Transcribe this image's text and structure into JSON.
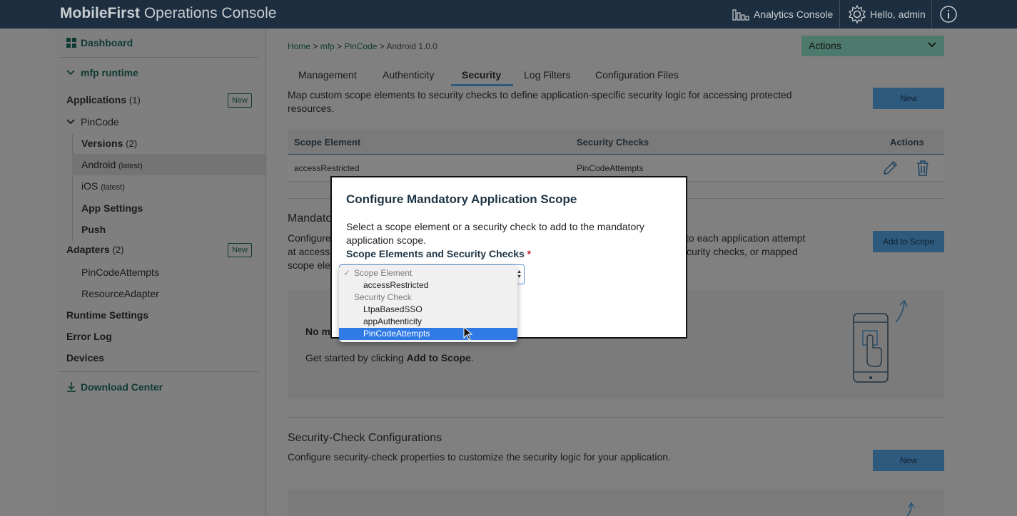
{
  "topbar": {
    "brand_bold": "MobileFirst",
    "brand_rest": " Operations Console",
    "analytics": "Analytics Console",
    "user": "Hello, admin"
  },
  "sidebar": {
    "dashboard": "Dashboard",
    "runtime": "mfp runtime",
    "applications": "Applications",
    "applications_count": "(1)",
    "new_label": "New",
    "pincode": "PinCode",
    "versions": "Versions",
    "versions_count": "(2)",
    "android": "Android",
    "android_tag": "(latest)",
    "ios": "iOS",
    "ios_tag": "(latest)",
    "app_settings": "App Settings",
    "push": "Push",
    "adapters": "Adapters",
    "adapters_count": "(2)",
    "adapter_1": "PinCodeAttempts",
    "adapter_2": "ResourceAdapter",
    "runtime_settings": "Runtime Settings",
    "error_log": "Error Log",
    "devices": "Devices",
    "download_center": "Download Center"
  },
  "breadcrumb": {
    "home": "Home",
    "runtime": "mfp",
    "app": "PinCode",
    "current": "Android 1.0.0",
    "sep": ">"
  },
  "actions_label": "Actions",
  "tabs": [
    "Management",
    "Authenticity",
    "Security",
    "Log Filters",
    "Configuration Files"
  ],
  "scope_section": {
    "description": "Map custom scope elements to security checks to define application-specific security logic for accessing protected resources.",
    "new_button": "New",
    "col_scope": "Scope Element",
    "col_checks": "Security Checks",
    "col_actions": "Actions",
    "row_scope": "accessRestricted",
    "row_checks": "PinCodeAttempts"
  },
  "mandatory_section": {
    "title_partial": "Mandato",
    "line1_left": "Configure",
    "line1_right": "to each application attempt",
    "line2_left": "at access",
    "line2_right": "curity checks, or mapped",
    "line3_left": "scope ele",
    "add_button": "Add to Scope",
    "empty_partial": "No m",
    "get_started_prefix": "Get started by clicking ",
    "get_started_bold": "Add to Scope",
    "get_started_suffix": "."
  },
  "security_check_section": {
    "title": "Security-Check Configurations",
    "description": "Configure security-check properties to customize the security logic for your application.",
    "new_button": "New"
  },
  "modal": {
    "title": "Configure Mandatory Application Scope",
    "text": "Select a scope element or a security check to add to the mandatory application scope.",
    "label": "Scope Elements and Security Checks",
    "required_mark": "*"
  },
  "dropdown": {
    "check_mark": "✓",
    "group_1": "Scope Element",
    "option_1": "accessRestricted",
    "group_2": "Security Check",
    "option_2": "LtpaBasedSSO",
    "option_3": "appAuthenticity",
    "option_4": "PinCodeAttempts"
  },
  "colors": {
    "topbar": "#1c2e3f",
    "accent_blue": "#2f7ae5",
    "brand_green": "#0f3a33"
  }
}
